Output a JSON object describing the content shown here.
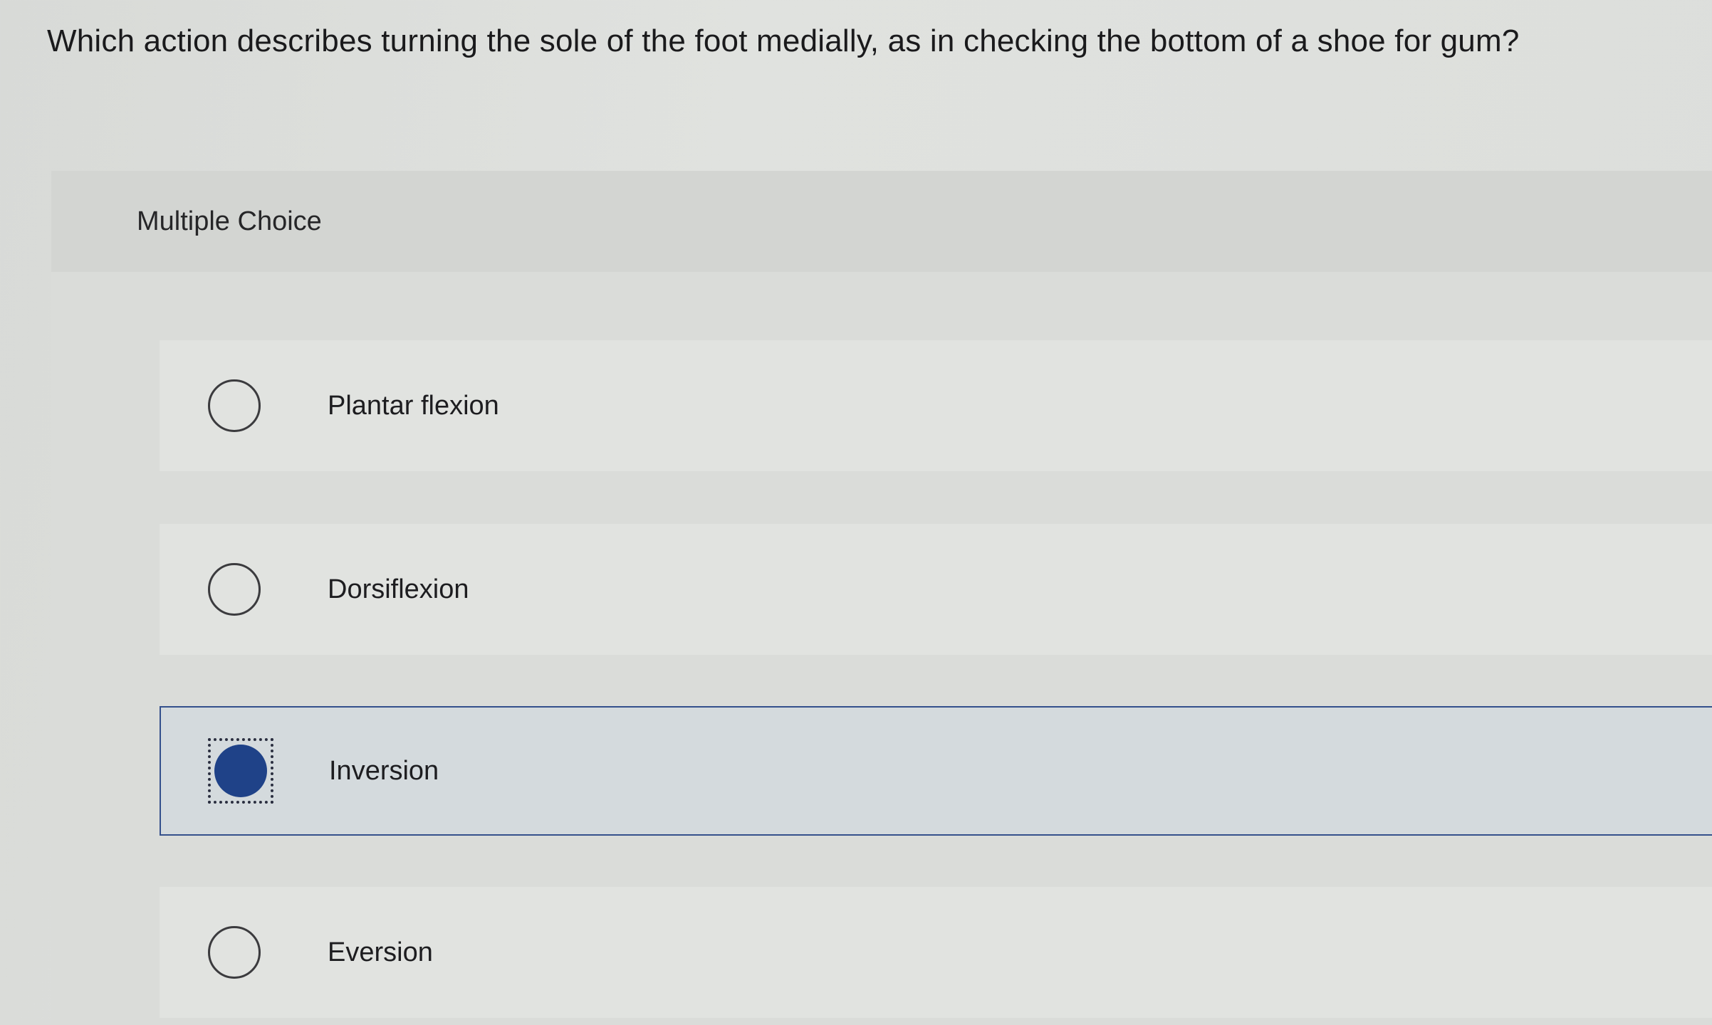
{
  "question": {
    "text": "Which action describes turning the sole of the foot medially, as in checking the bottom of a shoe for gum?"
  },
  "panel": {
    "type_label": "Multiple Choice"
  },
  "choices": [
    {
      "label": "Plantar flexion",
      "selected": false
    },
    {
      "label": "Dorsiflexion",
      "selected": false
    },
    {
      "label": "Inversion",
      "selected": true
    },
    {
      "label": "Eversion",
      "selected": false
    }
  ],
  "colors": {
    "selected_accent": "#1f4288",
    "selected_border": "#34508c",
    "selected_background": "#d4dadd"
  }
}
